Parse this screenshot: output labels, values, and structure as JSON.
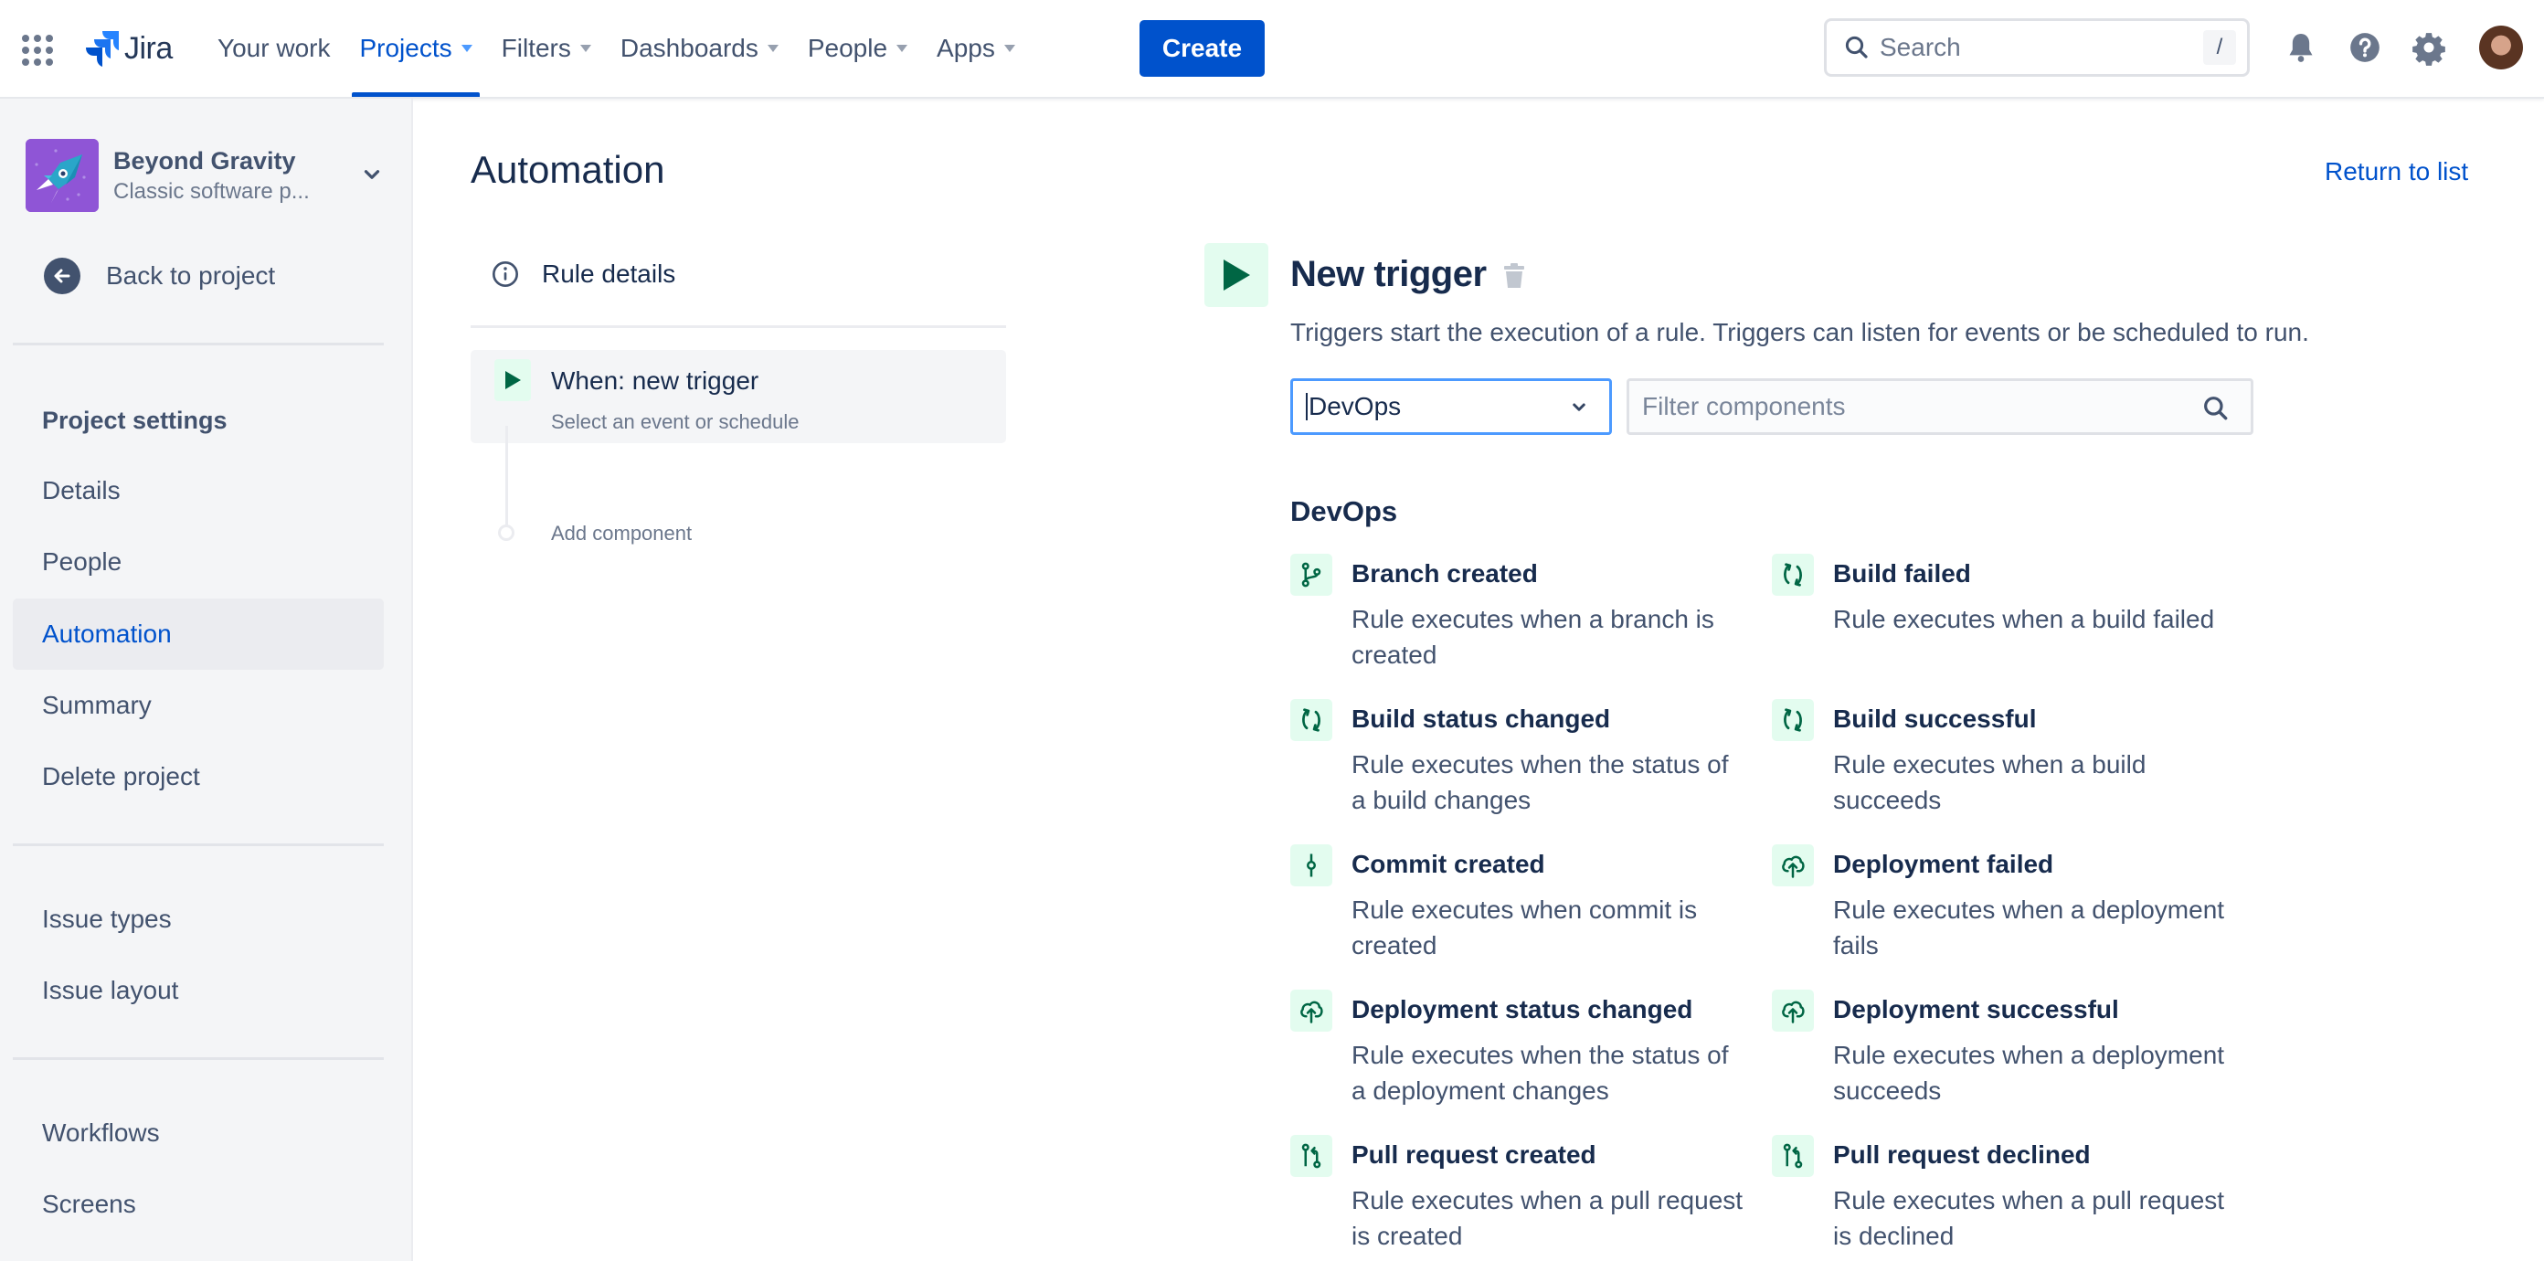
{
  "topbar": {
    "app": "Jira",
    "nav": [
      {
        "label": "Your work",
        "dropdown": false,
        "active": false
      },
      {
        "label": "Projects",
        "dropdown": true,
        "active": true
      },
      {
        "label": "Filters",
        "dropdown": true,
        "active": false
      },
      {
        "label": "Dashboards",
        "dropdown": true,
        "active": false
      },
      {
        "label": "People",
        "dropdown": true,
        "active": false
      },
      {
        "label": "Apps",
        "dropdown": true,
        "active": false
      }
    ],
    "create_label": "Create",
    "search": {
      "placeholder": "Search",
      "shortcut": "/"
    },
    "icons": [
      "app-switcher-icon",
      "notifications-icon",
      "help-icon",
      "settings-icon",
      "avatar"
    ]
  },
  "sidebar": {
    "project": {
      "name": "Beyond Gravity",
      "type": "Classic software p..."
    },
    "back_label": "Back to project",
    "heading": "Project settings",
    "items": [
      {
        "label": "Details",
        "active": false
      },
      {
        "label": "People",
        "active": false
      },
      {
        "label": "Automation",
        "active": true
      },
      {
        "label": "Summary",
        "active": false
      },
      {
        "label": "Delete project",
        "active": false
      },
      {
        "label": "Issue types",
        "active": false
      },
      {
        "label": "Issue layout",
        "active": false
      },
      {
        "label": "Workflows",
        "active": false
      },
      {
        "label": "Screens",
        "active": false
      }
    ]
  },
  "main": {
    "title": "Automation",
    "return_label": "Return to list",
    "rule_details_label": "Rule details",
    "trigger_card": {
      "title": "When: new trigger",
      "subtitle": "Select an event or schedule"
    },
    "add_component_label": "Add component",
    "new_trigger": {
      "title": "New trigger",
      "description": "Triggers start the execution of a rule. Triggers can listen for events or be scheduled to run.",
      "category_value": "DevOps",
      "filter_placeholder": "Filter components"
    },
    "section_title": "DevOps",
    "components": [
      {
        "title": "Branch created",
        "description": "Rule executes when a branch is created",
        "icon": "branch-icon"
      },
      {
        "title": "Build failed",
        "description": "Rule executes when a build failed",
        "icon": "build-icon"
      },
      {
        "title": "Build status changed",
        "description": "Rule executes when the status of a build changes",
        "icon": "build-icon"
      },
      {
        "title": "Build successful",
        "description": "Rule executes when a build succeeds",
        "icon": "build-icon"
      },
      {
        "title": "Commit created",
        "description": "Rule executes when commit is created",
        "icon": "commit-icon"
      },
      {
        "title": "Deployment failed",
        "description": "Rule executes when a deployment fails",
        "icon": "deployment-icon"
      },
      {
        "title": "Deployment status changed",
        "description": "Rule executes when the status of a deployment changes",
        "icon": "deployment-icon"
      },
      {
        "title": "Deployment successful",
        "description": "Rule executes when a deployment succeeds",
        "icon": "deployment-icon"
      },
      {
        "title": "Pull request created",
        "description": "Rule executes when a pull request is created",
        "icon": "pull-request-icon"
      },
      {
        "title": "Pull request declined",
        "description": "Rule executes when a pull request is declined",
        "icon": "pull-request-icon"
      }
    ]
  },
  "colors": {
    "brand": "#0052cc",
    "trigger_green": "#006644",
    "trigger_green_bg": "#e3fcef",
    "sidebar_bg": "#f4f5f7",
    "text": "#172b4d",
    "subtle_text": "#42526e"
  }
}
